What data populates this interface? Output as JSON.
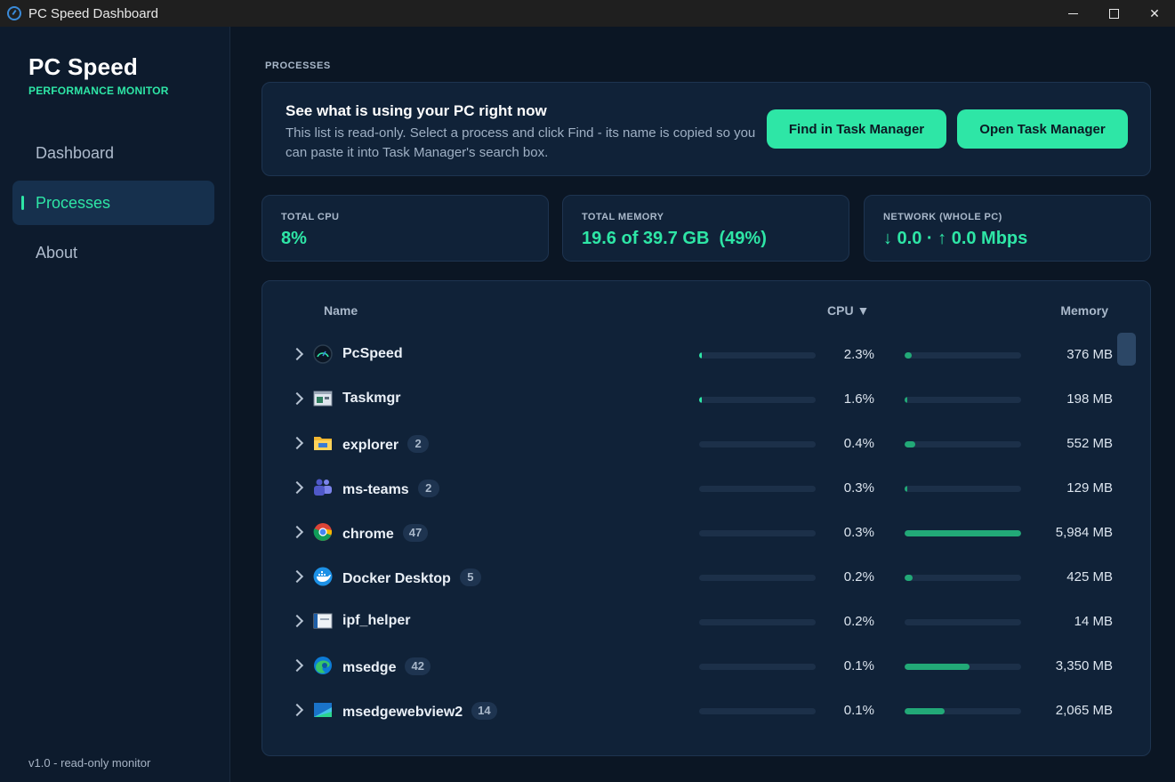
{
  "window": {
    "title": "PC Speed Dashboard"
  },
  "sidebar": {
    "brand": "PC Speed",
    "subtitle": "PERFORMANCE MONITOR",
    "items": [
      {
        "label": "Dashboard",
        "active": false
      },
      {
        "label": "Processes",
        "active": true
      },
      {
        "label": "About",
        "active": false
      }
    ],
    "version": "v1.0 - read-only monitor"
  },
  "section": "PROCESSES",
  "info": {
    "title": "See what is using your PC right now",
    "description": "This list is read-only. Select a process and click Find - its name is copied so you can paste it into Task Manager's search box.",
    "find_button": "Find in Task Manager",
    "open_button": "Open Task Manager"
  },
  "stats": [
    {
      "label": "TOTAL CPU",
      "value": "8%"
    },
    {
      "label": "TOTAL MEMORY",
      "value": "19.6 of 39.7 GB  (49%)"
    },
    {
      "label": "NETWORK (WHOLE PC)",
      "value": "↓ 0.0 · ↑ 0.0 Mbps"
    }
  ],
  "table": {
    "headers": {
      "name": "Name",
      "cpu": "CPU ▼",
      "memory": "Memory"
    },
    "rows": [
      {
        "name": "PcSpeed",
        "count": "",
        "icon": "gauge-icon",
        "cpu": "2.3%",
        "cpu_level": 0.02,
        "memory": "376 MB",
        "mem_level": 0.06
      },
      {
        "name": "Taskmgr",
        "count": "",
        "icon": "task-manager-icon",
        "cpu": "1.6%",
        "cpu_level": 0.015,
        "memory": "198 MB",
        "mem_level": 0.02
      },
      {
        "name": "explorer",
        "count": "2",
        "icon": "folder-icon",
        "cpu": "0.4%",
        "cpu_level": 0,
        "memory": "552 MB",
        "mem_level": 0.09
      },
      {
        "name": "ms-teams",
        "count": "2",
        "icon": "teams-icon",
        "cpu": "0.3%",
        "cpu_level": 0,
        "memory": "129 MB",
        "mem_level": 0.015
      },
      {
        "name": "chrome",
        "count": "47",
        "icon": "chrome-icon",
        "cpu": "0.3%",
        "cpu_level": 0,
        "memory": "5,984 MB",
        "mem_level": 1.0
      },
      {
        "name": "Docker Desktop",
        "count": "5",
        "icon": "docker-icon",
        "cpu": "0.2%",
        "cpu_level": 0,
        "memory": "425 MB",
        "mem_level": 0.07
      },
      {
        "name": "ipf_helper",
        "count": "",
        "icon": "window-icon",
        "cpu": "0.2%",
        "cpu_level": 0,
        "memory": "14 MB",
        "mem_level": 0
      },
      {
        "name": "msedge",
        "count": "42",
        "icon": "edge-icon",
        "cpu": "0.1%",
        "cpu_level": 0,
        "memory": "3,350 MB",
        "mem_level": 0.56
      },
      {
        "name": "msedgewebview2",
        "count": "14",
        "icon": "webview-icon",
        "cpu": "0.1%",
        "cpu_level": 0,
        "memory": "2,065 MB",
        "mem_level": 0.34
      }
    ]
  },
  "colors": {
    "accent": "#2ee6a6",
    "background": "#0b1624",
    "card": "#102238"
  }
}
